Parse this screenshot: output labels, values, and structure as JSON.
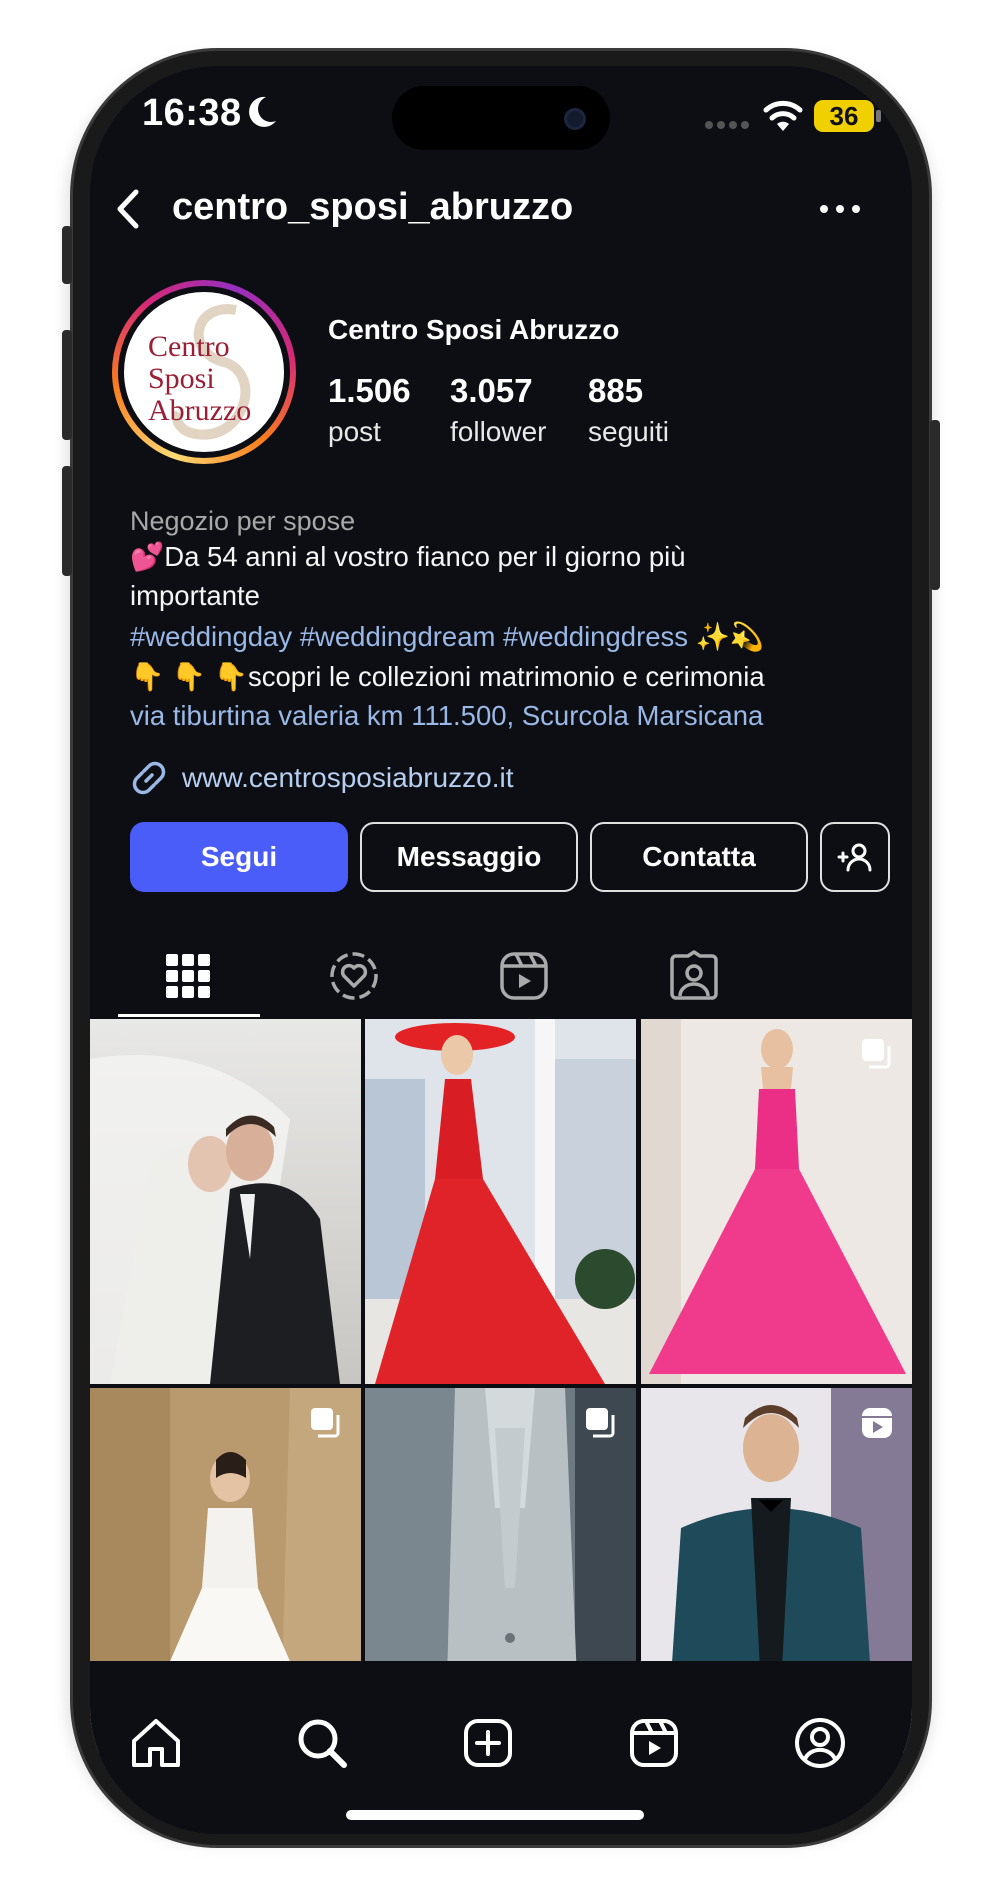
{
  "status_bar": {
    "time": "16:38",
    "battery": "36",
    "icons": [
      "moon-icon",
      "signal-icon",
      "wifi-icon",
      "battery-icon"
    ]
  },
  "header": {
    "username": "centro_sposi_abruzzo",
    "back_icon": "chevron-left-icon",
    "more_icon": "more-horizontal-icon"
  },
  "profile": {
    "avatar_logo_text": [
      "Centro",
      "Sposi",
      "Abruzzo"
    ],
    "display_name": "Centro Sposi Abruzzo",
    "stats": [
      {
        "value": "1.506",
        "label": "post"
      },
      {
        "value": "3.057",
        "label": "follower"
      },
      {
        "value": "885",
        "label": "seguiti"
      }
    ],
    "category": "Negozio per spose",
    "bio": {
      "line1_emoji": "💕",
      "line1": "Da 54 anni al vostro fianco per il giorno più",
      "line2": "importante",
      "hashtags": "#weddingday #weddingdream #weddingdress",
      "hashtags_emoji": "✨💫",
      "line4_emoji": "👇 👇 👇",
      "line4": "scopri le collezioni matrimonio e cerimonia",
      "address": "via tiburtina valeria km 111.500, Scurcola Marsicana"
    },
    "website": "www.centrosposiabruzzo.it"
  },
  "actions": {
    "follow": "Segui",
    "message": "Messaggio",
    "contact": "Contatta",
    "suggest_icon": "add-person-icon"
  },
  "tabs": [
    {
      "icon": "grid-icon",
      "selected": true
    },
    {
      "icon": "highlights-heart-icon",
      "selected": false
    },
    {
      "icon": "reels-icon",
      "selected": false
    },
    {
      "icon": "tagged-icon",
      "selected": false
    }
  ],
  "grid": [
    {
      "subject": "bride-and-groom",
      "badge": null
    },
    {
      "subject": "red-dress",
      "badge": null
    },
    {
      "subject": "pink-gown",
      "badge": "carousel-icon"
    },
    {
      "subject": "white-bridal-gown",
      "badge": "carousel-icon"
    },
    {
      "subject": "grey-waistcoat-suit",
      "badge": "carousel-icon"
    },
    {
      "subject": "teal-tuxedo",
      "badge": "reels-icon"
    }
  ],
  "bottom_nav": [
    "home-icon",
    "search-icon",
    "create-icon",
    "reels-icon",
    "profile-icon"
  ],
  "colors": {
    "background": "#0c0e14",
    "follow_button": "#4a5df9",
    "link": "#9ab8e6",
    "battery": "#f0d000"
  }
}
